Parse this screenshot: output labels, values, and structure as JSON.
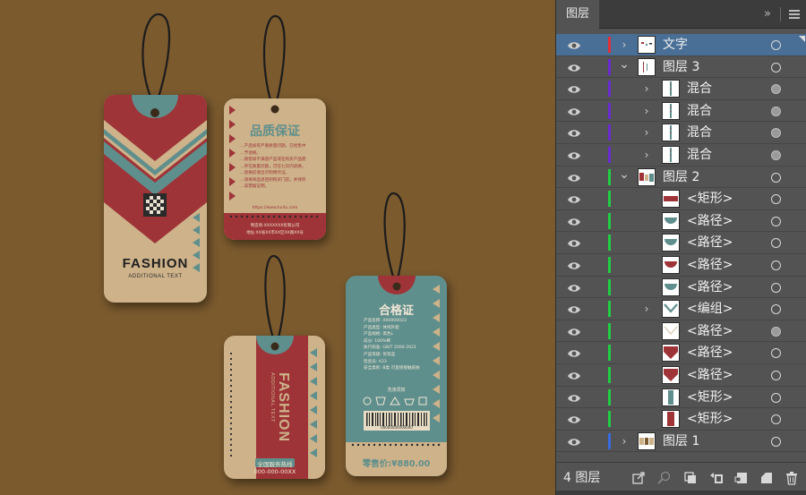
{
  "panel": {
    "tab_label": "图层",
    "collapse_glyph": "»",
    "layer_count_label": "4 图层",
    "footer_icons": [
      "export-icon",
      "search-icon",
      "collect-icon",
      "make-clip-mask-icon",
      "new-sublayer-icon",
      "new-layer-icon",
      "trash-icon"
    ]
  },
  "layers": [
    {
      "name": "文字",
      "indent": 0,
      "expanded": false,
      "color": "#e0303a",
      "selected": true,
      "target_filled": false,
      "thumb": "text"
    },
    {
      "name": "图层 3",
      "indent": 0,
      "expanded": true,
      "color": "#6a2bd0",
      "selected": false,
      "target_filled": false,
      "thumb": "layer3"
    },
    {
      "name": "混合",
      "indent": 1,
      "expanded": false,
      "color": "#6a2bd0",
      "selected": false,
      "target_filled": true,
      "thumb": "blend"
    },
    {
      "name": "混合",
      "indent": 1,
      "expanded": false,
      "color": "#6a2bd0",
      "selected": false,
      "target_filled": true,
      "thumb": "blend"
    },
    {
      "name": "混合",
      "indent": 1,
      "expanded": false,
      "color": "#6a2bd0",
      "selected": false,
      "target_filled": true,
      "thumb": "blend"
    },
    {
      "name": "混合",
      "indent": 1,
      "expanded": false,
      "color": "#6a2bd0",
      "selected": false,
      "target_filled": true,
      "thumb": "blend"
    },
    {
      "name": "图层 2",
      "indent": 0,
      "expanded": true,
      "color": "#22cc44",
      "selected": false,
      "target_filled": false,
      "thumb": "layer2"
    },
    {
      "name": "<矩形>",
      "indent": 2,
      "expanded": null,
      "color": "#22cc44",
      "selected": false,
      "target_filled": false,
      "thumb": "rect-red"
    },
    {
      "name": "<路径>",
      "indent": 2,
      "expanded": null,
      "color": "#22cc44",
      "selected": false,
      "target_filled": false,
      "thumb": "path-teal"
    },
    {
      "name": "<路径>",
      "indent": 2,
      "expanded": null,
      "color": "#22cc44",
      "selected": false,
      "target_filled": false,
      "thumb": "path-teal"
    },
    {
      "name": "<路径>",
      "indent": 2,
      "expanded": null,
      "color": "#22cc44",
      "selected": false,
      "target_filled": false,
      "thumb": "path-red"
    },
    {
      "name": "<路径>",
      "indent": 2,
      "expanded": null,
      "color": "#22cc44",
      "selected": false,
      "target_filled": false,
      "thumb": "path-teal"
    },
    {
      "name": "<编组>",
      "indent": 1,
      "expanded": false,
      "color": "#22cc44",
      "selected": false,
      "target_filled": false,
      "thumb": "group-v"
    },
    {
      "name": "<路径>",
      "indent": 2,
      "expanded": null,
      "color": "#22cc44",
      "selected": false,
      "target_filled": true,
      "thumb": "v-light"
    },
    {
      "name": "<路径>",
      "indent": 2,
      "expanded": null,
      "color": "#22cc44",
      "selected": false,
      "target_filled": false,
      "thumb": "v-red"
    },
    {
      "name": "<路径>",
      "indent": 2,
      "expanded": null,
      "color": "#22cc44",
      "selected": false,
      "target_filled": false,
      "thumb": "v-red"
    },
    {
      "name": "<矩形>",
      "indent": 2,
      "expanded": null,
      "color": "#22cc44",
      "selected": false,
      "target_filled": false,
      "thumb": "rect-teal"
    },
    {
      "name": "<矩形>",
      "indent": 2,
      "expanded": null,
      "color": "#22cc44",
      "selected": false,
      "target_filled": false,
      "thumb": "rect-red-v"
    },
    {
      "name": "图层 1",
      "indent": 0,
      "expanded": false,
      "color": "#3a6ae0",
      "selected": false,
      "target_filled": false,
      "thumb": "layer1"
    }
  ],
  "artwork": {
    "colors": {
      "red": "#9e3438",
      "teal": "#5f8f8c",
      "beige": "#cdb28a",
      "dark": "#2a2a2a",
      "bg": "#7b5a2e"
    },
    "tag1": {
      "title": "FASHION",
      "subtitle": "ADDITIONAL TEXT"
    },
    "tag2": {
      "title": "品质保证",
      "body": [
        "…产品如有严重质量问题，已经售中",
        "…予退换。",
        "…顾客如不满意产品或在购买产品使",
        "…存在质量问题，可在七日内退换，",
        "…退换前请出示购物凭证。",
        "…请将商品退回到购买门店，并保存",
        "…该票据证明。"
      ],
      "url": "https://www.huitu.com",
      "footer1": "制造商:XXXXXXX有限公司",
      "footer2": "地址:XX省XX市XX区XX路XX号"
    },
    "tag3": {
      "title": "FASHION",
      "subtitle": "ADDITIONAL TEXT",
      "hotline_label": "全国服务热线",
      "hotline": "000-000-00XX"
    },
    "tag4": {
      "title": "合格证",
      "lines": [
        "产品名称: X00000023",
        "产品类型: 休闲外套",
        "产品规格: 黑色L",
        "成分: 100%棉",
        "执行标准: GB/T 2000-2021",
        "产品等级: 优等品",
        "检验员: A33",
        "安全类别: B类 可直接接触皮肤"
      ],
      "wash_label": "洗涤须知",
      "barcode_number": "00000000000000",
      "price": "零售价:¥880.00"
    }
  }
}
